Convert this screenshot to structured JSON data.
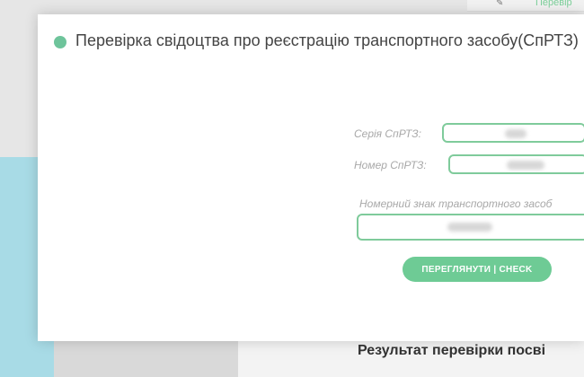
{
  "background": {
    "header_link": "Перевір",
    "result_title": "Результат перевірки посві"
  },
  "modal": {
    "title": "Перевірка свідоцтва про реєстрацію транспортного засобу(СпРТЗ)",
    "fields": {
      "series_label": "Серія СпРТЗ:",
      "number_label": "Номер СпРТЗ:",
      "plate_label": "Номерний знак транспортного засоб"
    },
    "check_button": "ПЕРЕГЛЯНУТИ | CHECK"
  },
  "colors": {
    "accent": "#6ecb95",
    "input_border": "#7fcb9b",
    "status_dot": "#6ec49b"
  }
}
